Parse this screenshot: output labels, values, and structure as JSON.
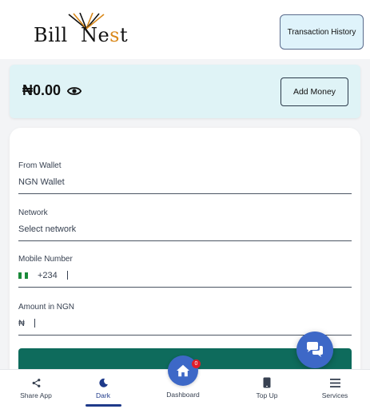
{
  "header": {
    "logo_text_1": "Bill",
    "logo_text_2": "Ne",
    "logo_text_accent": "s",
    "logo_text_3": "t",
    "history_button": "Transaction History"
  },
  "balance": {
    "amount": "₦0.00",
    "add_money_button": "Add Money"
  },
  "form": {
    "from_wallet_label": "From Wallet",
    "from_wallet_value": "NGN Wallet",
    "network_label": "Network",
    "network_placeholder": "Select network",
    "mobile_label": "Mobile Number",
    "mobile_prefix": "+234",
    "amount_label": "Amount in NGN",
    "amount_currency": "₦"
  },
  "nav": {
    "share": "Share App",
    "dark": "Dark",
    "dashboard": "Dashboard",
    "topup": "Top Up",
    "services": "Services",
    "badge_count": "0"
  },
  "colors": {
    "accent": "#3d68c7",
    "brand_green": "#0e6b5c",
    "balance_bg": "#dff3f6",
    "badge": "#e11d2a"
  },
  "icons": [
    "eye-icon",
    "chat-icon",
    "share-icon",
    "moon-icon",
    "home-icon",
    "phone-icon",
    "menu-icon",
    "nigeria-flag-icon"
  ]
}
